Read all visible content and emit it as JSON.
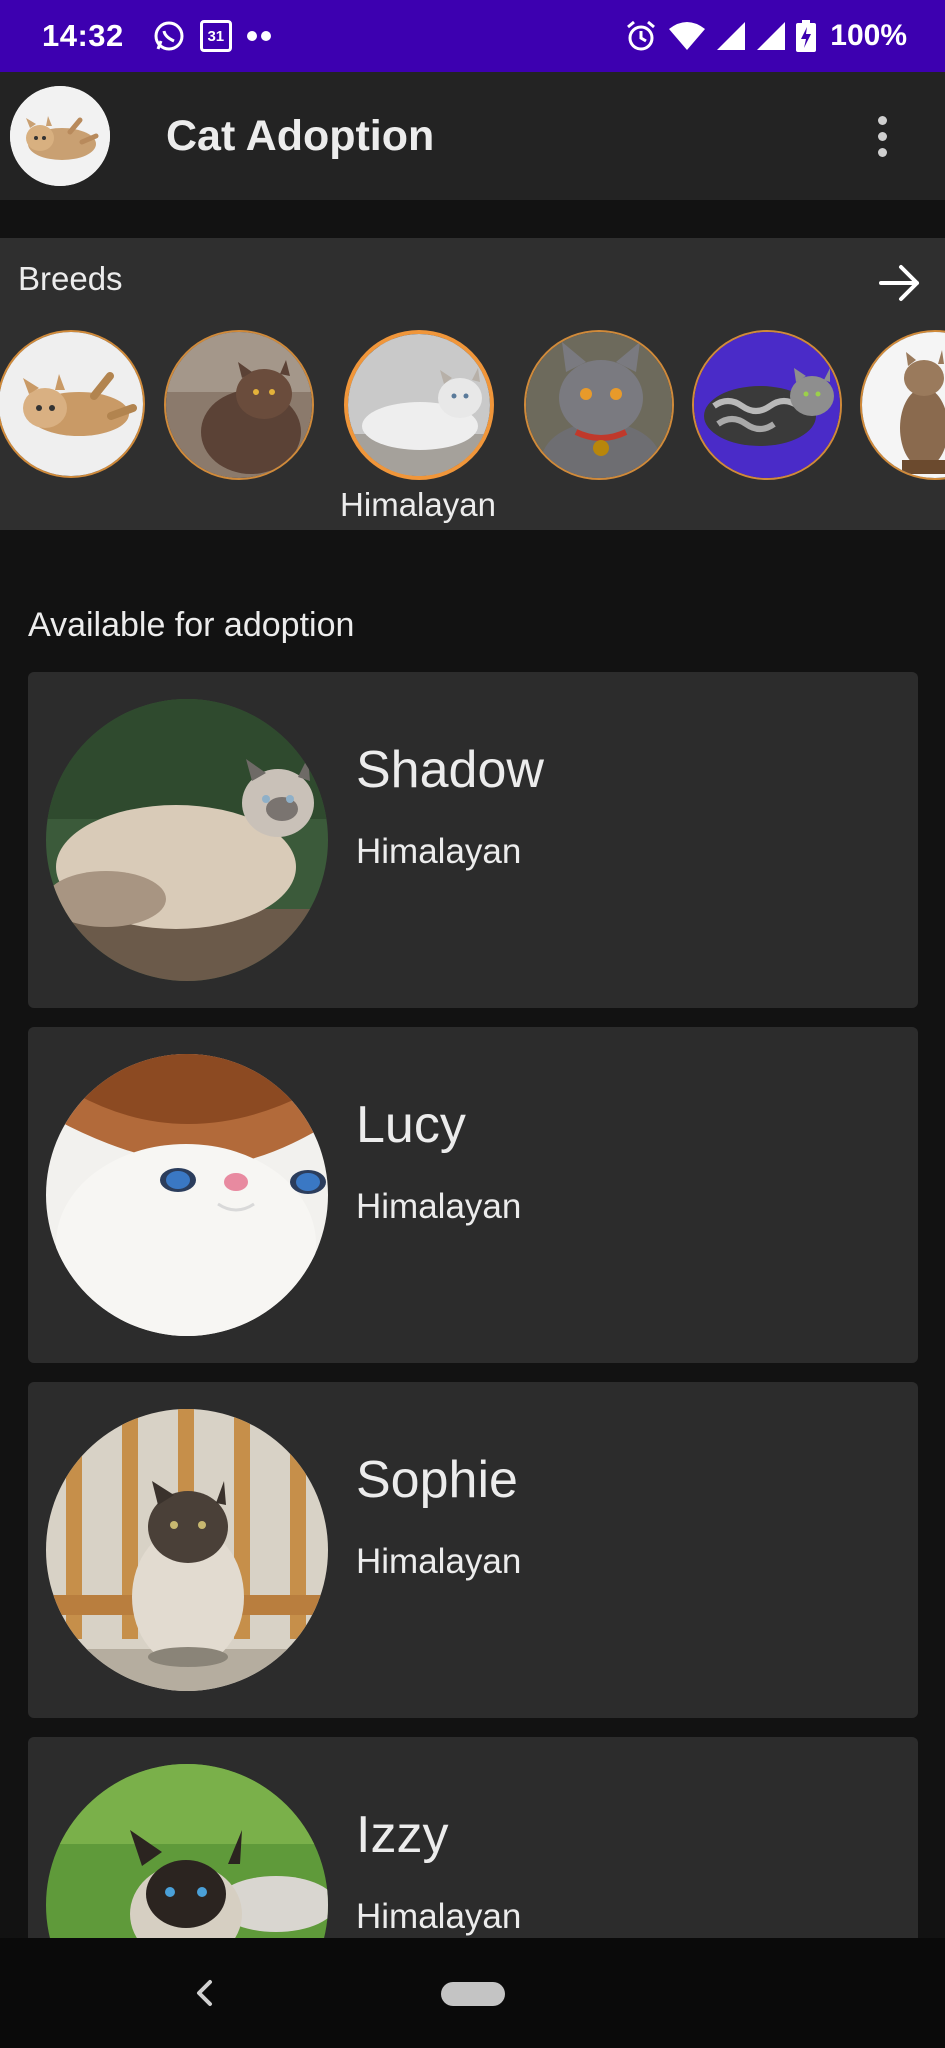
{
  "status_bar": {
    "time": "14:32",
    "calendar_day": "31",
    "battery": "100%",
    "icons": [
      "whatsapp-icon",
      "calendar-icon",
      "more-notifications-icon",
      "alarm-icon",
      "wifi-icon",
      "signal-icon",
      "signal-icon",
      "battery-charging-icon"
    ]
  },
  "app_bar": {
    "title": "Cat Adoption",
    "logo_icon": "cat-logo",
    "menu_icon": "overflow-menu-icon"
  },
  "breeds": {
    "title": "Breeds",
    "arrow_icon": "arrow-right-icon",
    "selected_label": "Himalayan",
    "items": [
      {
        "photo": "tabby-cat-lying"
      },
      {
        "photo": "long-haired-brown-cat"
      },
      {
        "photo": "himalayan-white-cat",
        "selected": true
      },
      {
        "photo": "grey-cat-with-bell"
      },
      {
        "photo": "silver-tabby-cat"
      },
      {
        "photo": "tabby-cat-sitting"
      }
    ]
  },
  "available": {
    "title": "Available for adoption",
    "cats": [
      {
        "name": "Shadow",
        "breed": "Himalayan"
      },
      {
        "name": "Lucy",
        "breed": "Himalayan"
      },
      {
        "name": "Sophie",
        "breed": "Himalayan"
      },
      {
        "name": "Izzy",
        "breed": "Himalayan"
      }
    ]
  },
  "colors": {
    "status_bar": "#3d00b0",
    "app_bar": "#232323",
    "panel": "#2f2f2f",
    "card": "#2c2c2c",
    "accent_border": "#f0963a",
    "background": "#121212"
  }
}
